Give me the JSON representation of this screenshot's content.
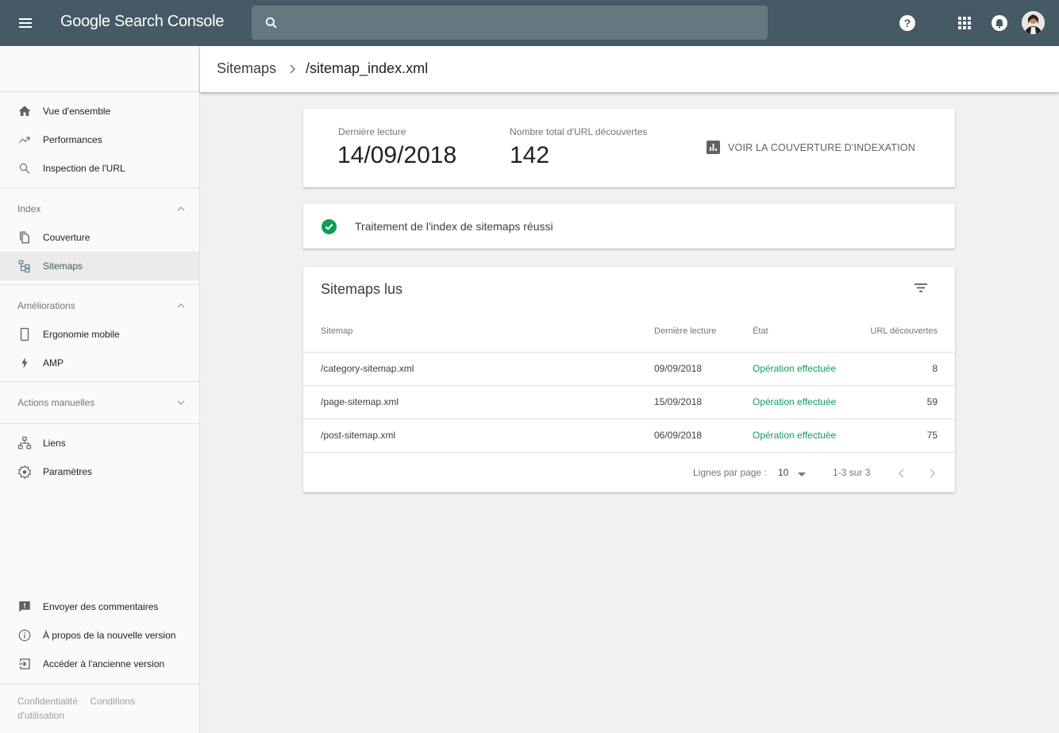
{
  "topbar": {
    "logo_google": "Google",
    "logo_product": "Search Console",
    "search_placeholder": "",
    "icons": [
      "menu-icon",
      "search-icon",
      "help-icon",
      "apps-icon",
      "notifications-icon",
      "account-avatar"
    ]
  },
  "sidebar": {
    "items_top": [
      {
        "label": "Vue d'ensemble",
        "icon": "home-icon"
      },
      {
        "label": "Performances",
        "icon": "trending-up-icon"
      },
      {
        "label": "Inspection de l'URL",
        "icon": "search-icon"
      }
    ],
    "index_section": {
      "label": "Index",
      "expanded": true,
      "items": [
        {
          "label": "Couverture",
          "icon": "coverage-icon"
        },
        {
          "label": "Sitemaps",
          "icon": "sitemap-icon",
          "active": true
        }
      ]
    },
    "enhancements_section": {
      "label": "Améliorations",
      "expanded": true,
      "items": [
        {
          "label": "Ergonomie mobile",
          "icon": "smartphone-icon"
        },
        {
          "label": "AMP",
          "icon": "bolt-icon"
        }
      ]
    },
    "manual_actions_section": {
      "label": "Actions manuelles",
      "expanded": false
    },
    "items_misc": [
      {
        "label": "Liens",
        "icon": "links-icon"
      },
      {
        "label": "Paramètres",
        "icon": "settings-icon"
      }
    ],
    "items_bottom": [
      {
        "label": "Envoyer des commentaires",
        "icon": "feedback-icon"
      },
      {
        "label": "À propos de la nouvelle version",
        "icon": "info-icon"
      },
      {
        "label": "Accéder à l'ancienne version",
        "icon": "exit-icon"
      }
    ],
    "footer": {
      "privacy": "Confidentialité",
      "terms": "Conditions d'utilisation"
    }
  },
  "header": {
    "breadcrumb_parent": "Sitemaps",
    "breadcrumb_current": "/sitemap_index.xml"
  },
  "summary": {
    "last_read_label": "Dernière lecture",
    "last_read_value": "14/09/2018",
    "total_urls_label": "Nombre total d'URL découvertes",
    "total_urls_value": "142",
    "coverage_link": "VOIR LA COUVERTURE D'INDEXATION"
  },
  "status": {
    "message": "Traitement de l'index de sitemaps réussi",
    "color": "#0f9d58"
  },
  "sitemaps_table": {
    "title": "Sitemaps lus",
    "columns": [
      "Sitemap",
      "Dernière lecture",
      "État",
      "URL découvertes"
    ],
    "rows": [
      {
        "sitemap": "/category-sitemap.xml",
        "last_read": "09/09/2018",
        "status": "Opération effectuée",
        "urls": "8"
      },
      {
        "sitemap": "/page-sitemap.xml",
        "last_read": "15/09/2018",
        "status": "Opération effectuée",
        "urls": "59"
      },
      {
        "sitemap": "/post-sitemap.xml",
        "last_read": "06/09/2018",
        "status": "Opération effectuée",
        "urls": "75"
      }
    ],
    "pagination": {
      "rows_per_page_label": "Lignes par page :",
      "rows_per_page_value": "10",
      "range": "1-3 sur 3"
    }
  },
  "colors": {
    "topbar": "#455a64",
    "success": "#0f9d58",
    "sidebar_bg": "#fafafa",
    "page_bg": "#f1f1f1"
  }
}
